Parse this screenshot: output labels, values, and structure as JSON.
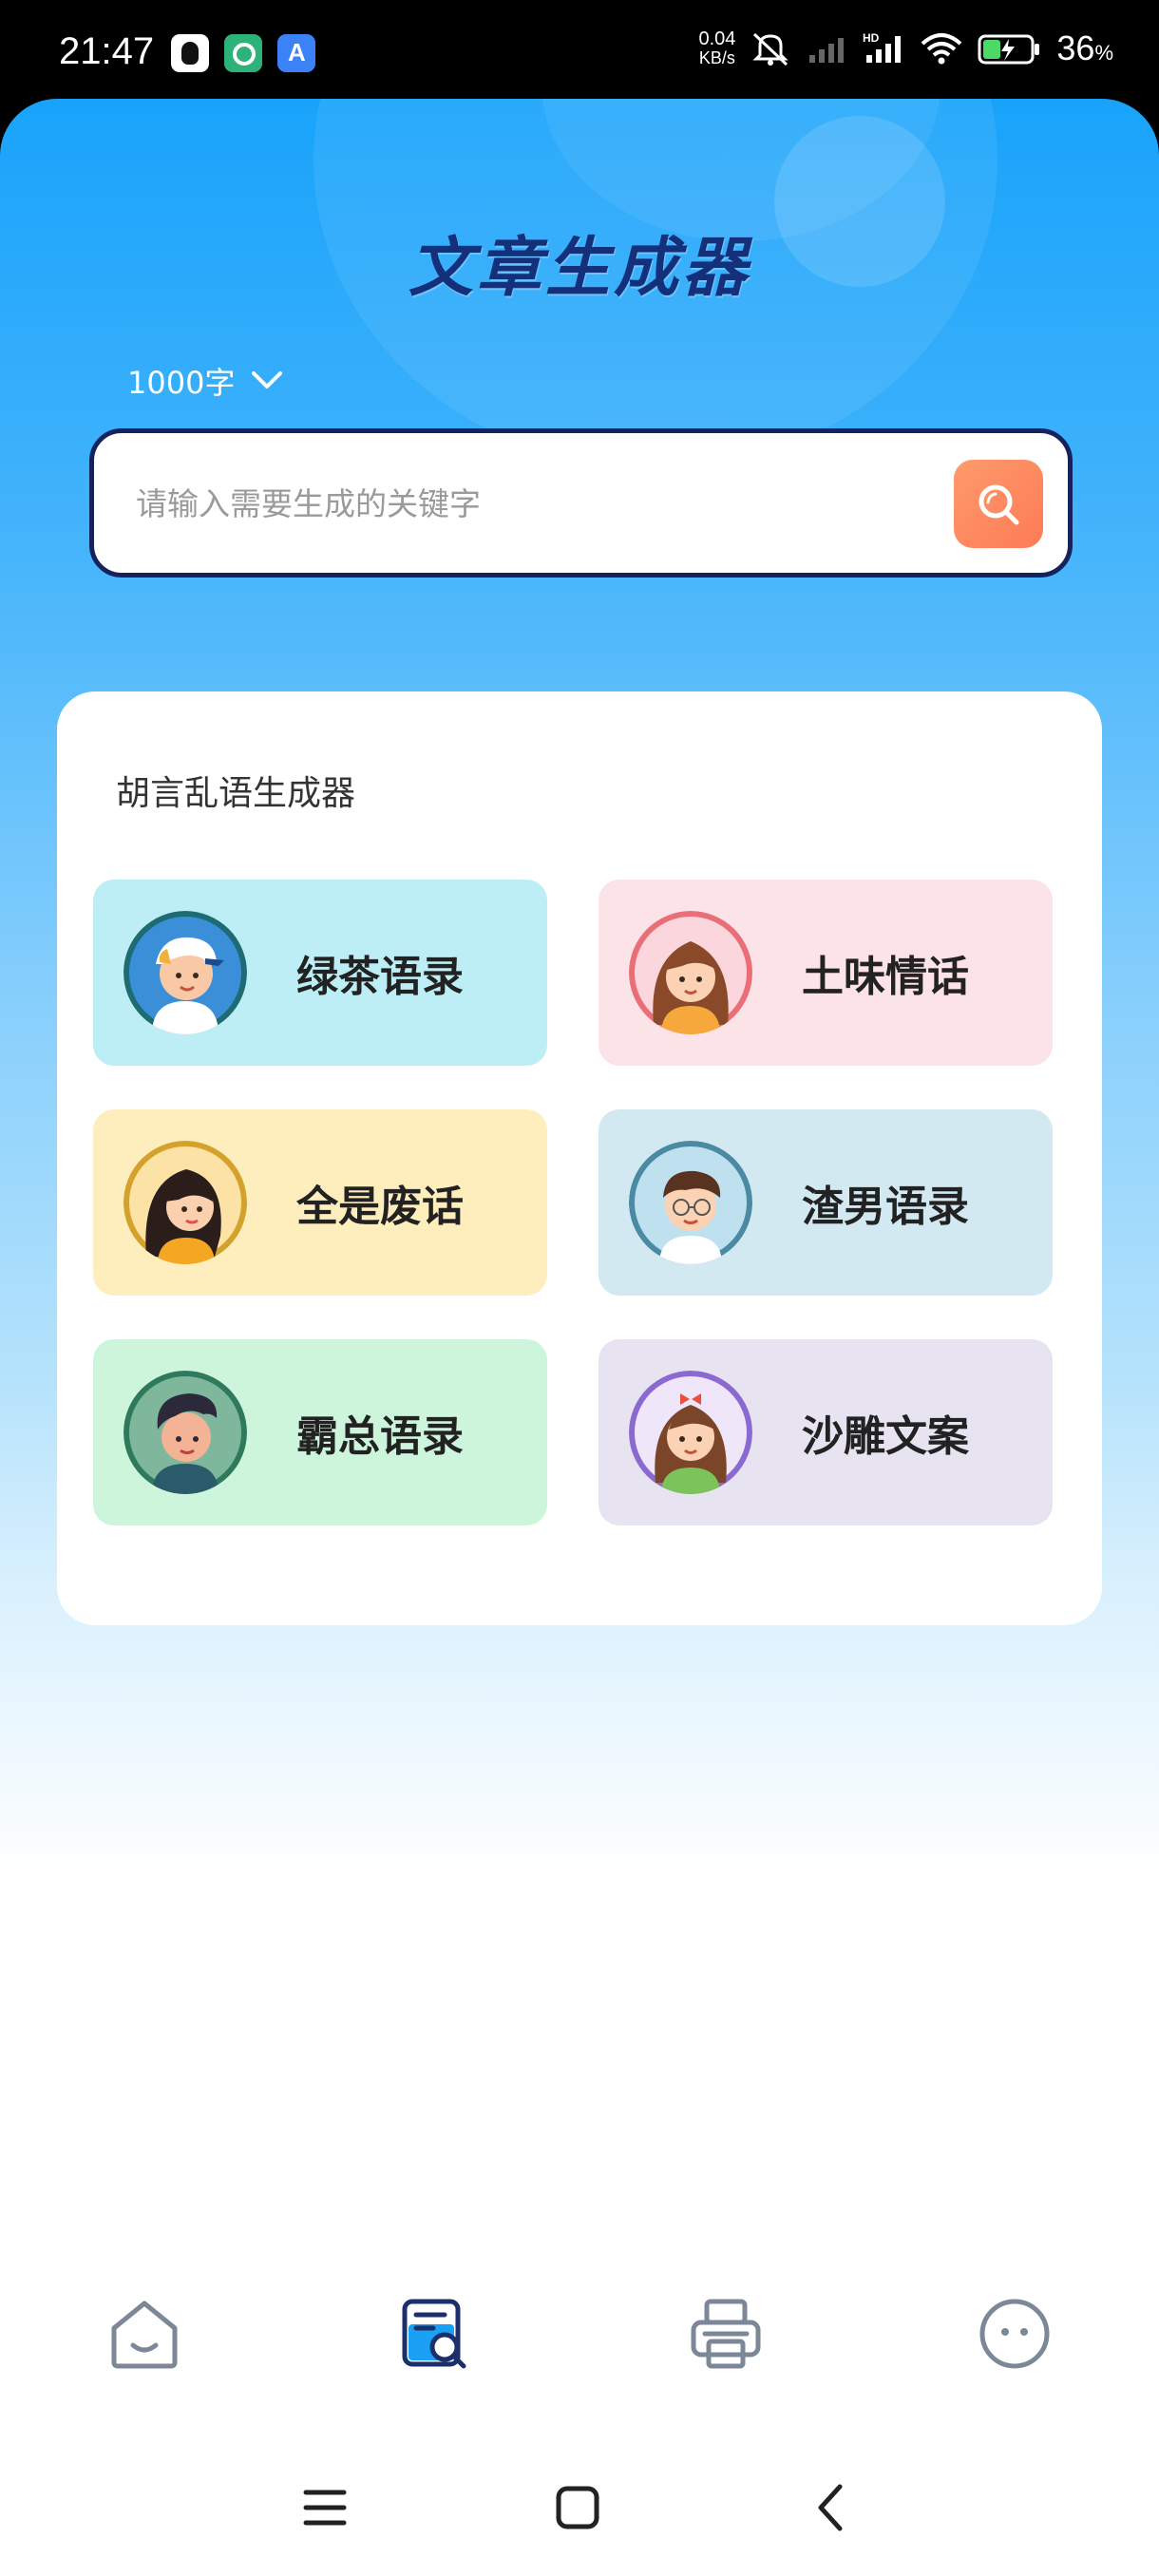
{
  "status_bar": {
    "time": "21:47",
    "net_speed_value": "0.04",
    "net_speed_unit": "KB/s",
    "signal_label": "HD",
    "battery_percent": "36",
    "battery_unit": "%",
    "app_icons": [
      "qq-icon",
      "green-app-icon",
      "app-store-icon"
    ]
  },
  "header": {
    "title": "文章生成器"
  },
  "word_count": {
    "selected": "1000字"
  },
  "search": {
    "placeholder": "请输入需要生成的关键字",
    "value": ""
  },
  "generator_card": {
    "title": "胡言乱语生成器",
    "tiles": [
      {
        "label": "绿茶语录",
        "bg": "#bdeef6",
        "ring": "#1f6b74",
        "avatar": "boy-cap-avatar"
      },
      {
        "label": "土味情话",
        "bg": "#fbe3e8",
        "ring": "#e96e78",
        "avatar": "girl-brown-hair-avatar"
      },
      {
        "label": "全是废话",
        "bg": "#feeebe",
        "ring": "#d3a12c",
        "avatar": "girl-dark-hair-avatar"
      },
      {
        "label": "渣男语录",
        "bg": "#d3e9f2",
        "ring": "#4a8aa3",
        "avatar": "boy-glasses-avatar"
      },
      {
        "label": "霸总语录",
        "bg": "#cdf5dc",
        "ring": "#2f7a5c",
        "avatar": "man-quiff-avatar"
      },
      {
        "label": "沙雕文案",
        "bg": "#e7e3f1",
        "ring": "#8a6ad1",
        "avatar": "girl-bow-avatar"
      }
    ]
  },
  "bottom_nav": {
    "active_index": 1,
    "items": [
      "home-icon",
      "article-search-icon",
      "printer-icon",
      "chat-face-icon"
    ],
    "colors": {
      "inactive": "#7c8797",
      "active": "#1b2f6b",
      "accent": "#1aa0f5"
    }
  },
  "system_nav": [
    "menu-icon",
    "home-square-icon",
    "back-icon"
  ]
}
